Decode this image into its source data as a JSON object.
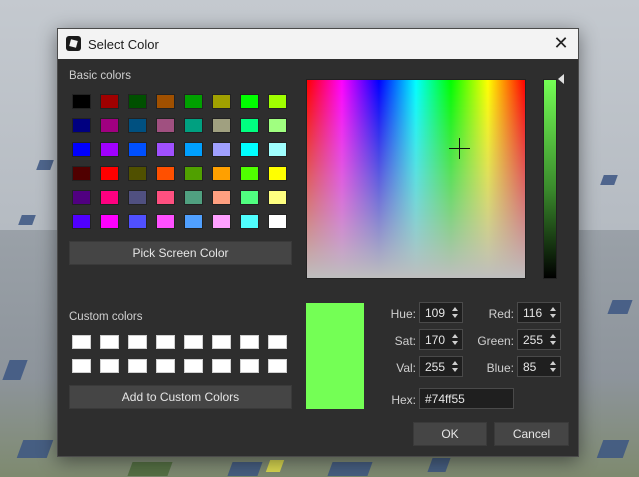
{
  "dialog": {
    "title": "Select Color",
    "close_glyph": "✕"
  },
  "basic_colors": {
    "label": "Basic colors",
    "swatches": [
      "#000000",
      "#a00000",
      "#005000",
      "#a05000",
      "#00a000",
      "#a0a000",
      "#00ff00",
      "#a0ff00",
      "#000080",
      "#a00080",
      "#005080",
      "#a05080",
      "#00a080",
      "#a0a080",
      "#00ff80",
      "#a0ff80",
      "#0000ff",
      "#a000ff",
      "#0050ff",
      "#a050ff",
      "#00a0ff",
      "#a0a0ff",
      "#00ffff",
      "#a0ffff",
      "#500000",
      "#ff0000",
      "#505000",
      "#ff5000",
      "#50a000",
      "#ffa000",
      "#50ff00",
      "#ffff00",
      "#500080",
      "#ff0080",
      "#505080",
      "#ff5080",
      "#50a080",
      "#ffa080",
      "#50ff80",
      "#ffff80",
      "#5000ff",
      "#ff00ff",
      "#5050ff",
      "#ff50ff",
      "#50a0ff",
      "#ffa0ff",
      "#50ffff",
      "#ffffff"
    ]
  },
  "pick_screen_color_label": "Pick Screen Color",
  "custom_colors": {
    "label": "Custom colors",
    "swatches": [
      "#ffffff",
      "#ffffff",
      "#ffffff",
      "#ffffff",
      "#ffffff",
      "#ffffff",
      "#ffffff",
      "#ffffff",
      "#ffffff",
      "#ffffff",
      "#ffffff",
      "#ffffff",
      "#ffffff",
      "#ffffff",
      "#ffffff",
      "#ffffff"
    ]
  },
  "add_custom_label": "Add to Custom Colors",
  "current_color": "#74ff55",
  "fields": {
    "hue": {
      "label": "Hue:",
      "value": "109"
    },
    "sat": {
      "label": "Sat:",
      "value": "170"
    },
    "val": {
      "label": "Val:",
      "value": "255"
    },
    "red": {
      "label": "Red:",
      "value": "116"
    },
    "green": {
      "label": "Green:",
      "value": "255"
    },
    "blue": {
      "label": "Blue:",
      "value": "85"
    }
  },
  "hex": {
    "label": "Hex:",
    "value": "#74ff55"
  },
  "buttons": {
    "ok": "OK",
    "cancel": "Cancel"
  }
}
